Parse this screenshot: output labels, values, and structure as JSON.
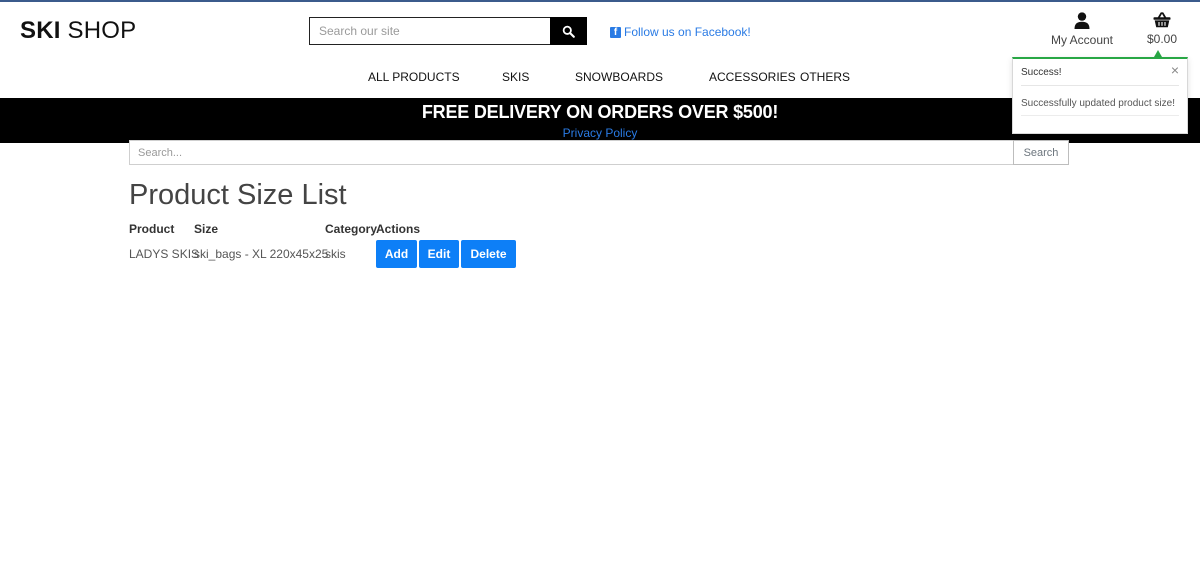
{
  "header": {
    "logo_bold": "SKI",
    "logo_rest": "SHOP",
    "search_placeholder": "Search our site",
    "facebook_link": "Follow us on Facebook!",
    "account_label": "My Account",
    "basket_total": "$0.00"
  },
  "nav": {
    "items": [
      "ALL PRODUCTS",
      "SKIS",
      "SNOWBOARDS",
      "ACCESSORIES",
      "OTHERS"
    ]
  },
  "banner": {
    "headline": "FREE DELIVERY ON ORDERS OVER $500!",
    "privacy_link": "Privacy Policy"
  },
  "toast": {
    "title": "Success!",
    "close": "×",
    "message": "Successfully updated product size!",
    "accent_color": "#28a745"
  },
  "list_search": {
    "placeholder": "Search...",
    "button": "Search"
  },
  "page": {
    "title": "Product Size List"
  },
  "table": {
    "headers": [
      "Product",
      "Size",
      "Category",
      "Actions"
    ],
    "rows": [
      {
        "product": "LADYS SKIS",
        "size": "ski_bags - XL 220x45x25",
        "category": "skis",
        "actions": [
          "Add",
          "Edit",
          "Delete"
        ]
      }
    ]
  },
  "colors": {
    "primary_button": "#0d7ff7",
    "link": "#2a7be4",
    "banner_bg": "#000000"
  },
  "icons": [
    "search-icon",
    "facebook-icon",
    "user-icon",
    "basket-icon",
    "close-icon"
  ]
}
